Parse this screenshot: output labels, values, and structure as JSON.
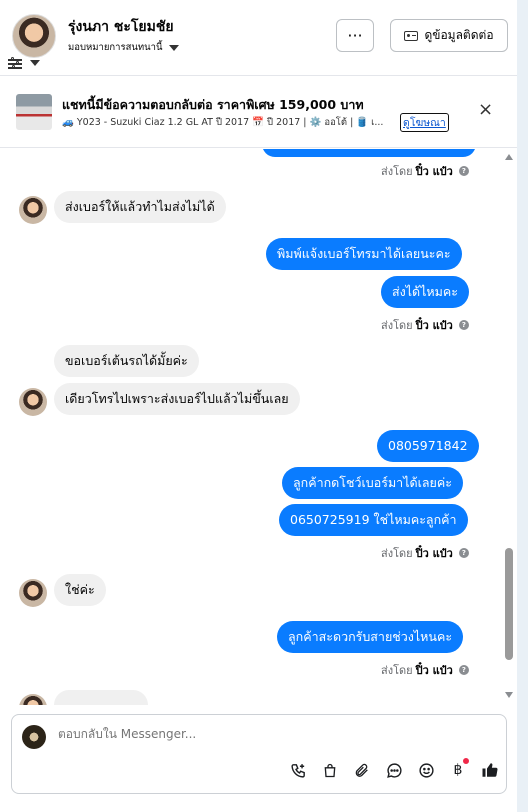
{
  "header": {
    "name": "รุ่งนภา ชะโยมชัย",
    "assign_label": "มอบหมายการสนทนานี้",
    "more_label": "···",
    "contact_label": "ดูข้อมูลติดต่อ"
  },
  "ad": {
    "title": "แชทนี้มีข้อความตอบกลับต่อ ราคาพิเศษ 159,000 บาท",
    "description": "🚙 Y023 - Suzuki Ciaz 1.2 GL AT ปี 2017 📅 ปี 2017 | ⚙️ ออโต้ | 🛢️ เ...",
    "link": "ดูโฆษณา",
    "close": "×"
  },
  "messages": {
    "sent_by_prefix": "ส่งโดย",
    "sender": "ปิ๋ว แป๋ว",
    "m1": "ส่งเบอร์ให้แล้วทำไมส่งไม่ได้",
    "m2": "พิมพ์แจ้งเบอร์โทรมาได้เลยนะคะ",
    "m3": "ส่งได้ไหมคะ",
    "m4": "ขอเบอร์เต้นรถได้มั้ยค่ะ",
    "m5": "เดียวโทรไปเพราะส่งเบอร์ไปแล้วไม่ขึ้นเลย",
    "m6": "0805971842",
    "m7": "ลูกค้ากดโชว์เบอร์มาได้เลยค่ะ",
    "m8": "0650725919  ใช่ไหมคะลูกค้า",
    "m9": "ใช่ค่ะ",
    "m10": "ลูกค้าสะดวกรับสายช่วงไหนคะ"
  },
  "composer": {
    "placeholder": "ตอบกลับใน Messenger..."
  },
  "icons": {
    "phone": "phone-add-icon",
    "bag": "shopping-bag-icon",
    "attach": "paperclip-icon",
    "chat": "chat-bubble-icon",
    "emoji": "emoji-icon",
    "baht": "baht-icon",
    "like": "thumbs-up-icon"
  },
  "colors": {
    "outgoing_bubble": "#0a7cff",
    "incoming_bubble": "#f0f0f0",
    "notification_dot": "#f02849"
  }
}
